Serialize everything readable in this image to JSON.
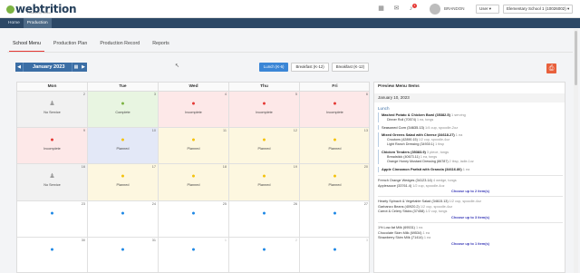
{
  "header": {
    "logo_text": "webtrition",
    "logo_tagline": "Powered by Sodexo",
    "notification_count": "1",
    "user_name": "BRANDON",
    "user_select": "User",
    "school_select": "Elementary School 1 (10026002)"
  },
  "nav": {
    "items": [
      "Home",
      "Production"
    ],
    "active": 1
  },
  "tabs": {
    "items": [
      "School Menu",
      "Production Plan",
      "Production Record",
      "Reports"
    ],
    "active": 0
  },
  "toolbar": {
    "prev": "◀",
    "month": "January 2023",
    "calendar_icon": "▦",
    "next": "▶",
    "meal_buttons": [
      "Lunch (K-6)",
      "Breakfast (K-12)",
      "Breakfast (K-12)"
    ],
    "active_meal": 0
  },
  "calendar": {
    "day_headers": [
      "Mon",
      "Tue",
      "Wed",
      "Thu",
      "Fri"
    ],
    "weeks": [
      [
        {
          "day": "2",
          "status": "No Service",
          "kind": "none"
        },
        {
          "day": "3",
          "status": "Complete",
          "kind": "complete"
        },
        {
          "day": "4",
          "status": "Incomplete",
          "kind": "incomplete"
        },
        {
          "day": "5",
          "status": "Incomplete",
          "kind": "incomplete"
        },
        {
          "day": "6",
          "status": "Incomplete",
          "kind": "incomplete"
        }
      ],
      [
        {
          "day": "9",
          "status": "Incomplete",
          "kind": "incomplete"
        },
        {
          "day": "10",
          "status": "Planned",
          "kind": "today"
        },
        {
          "day": "11",
          "status": "Planned",
          "kind": "planned"
        },
        {
          "day": "12",
          "status": "Planned",
          "kind": "planned"
        },
        {
          "day": "13",
          "status": "Planned",
          "kind": "planned"
        }
      ],
      [
        {
          "day": "16",
          "status": "No Service",
          "kind": "none"
        },
        {
          "day": "17",
          "status": "Planned",
          "kind": "planned"
        },
        {
          "day": "18",
          "status": "Planned",
          "kind": "planned"
        },
        {
          "day": "19",
          "status": "Planned",
          "kind": "planned"
        },
        {
          "day": "20",
          "status": "Planned",
          "kind": "planned"
        }
      ],
      [
        {
          "day": "23",
          "status": "",
          "kind": "empty"
        },
        {
          "day": "24",
          "status": "",
          "kind": "empty"
        },
        {
          "day": "25",
          "status": "",
          "kind": "empty"
        },
        {
          "day": "26",
          "status": "",
          "kind": "empty"
        },
        {
          "day": "27",
          "status": "",
          "kind": "empty"
        }
      ],
      [
        {
          "day": "30",
          "status": "",
          "kind": "empty"
        },
        {
          "day": "31",
          "status": "",
          "kind": "empty"
        },
        {
          "day": "1",
          "status": "",
          "kind": "empty",
          "out": true
        },
        {
          "day": "2",
          "status": "",
          "kind": "empty",
          "out": true
        },
        {
          "day": "3",
          "status": "",
          "kind": "empty",
          "out": true
        }
      ]
    ],
    "colors": {
      "none": "#9e9e9e",
      "complete": "#7cb342",
      "incomplete": "#e53935",
      "planned": "#f4c20d",
      "today": "#f4c20d",
      "empty": "#1e88e5"
    }
  },
  "preview": {
    "title": "Preview Menu Items",
    "date": "January 10, 2023",
    "meal": "Lunch",
    "groups": [
      {
        "items": [
          {
            "name": "Mashed Potato & Chicken Bowl (35382.5)",
            "serving": "1 serving",
            "sub": false
          },
          {
            "name": "Dinner Roll (70574)",
            "serving": "1 ea, tongs",
            "sub": true
          }
        ]
      },
      {
        "items": [
          {
            "name": "Seasoned Corn (34635.13)",
            "serving": "1/4 cup, spoodle-2oz",
            "plain": true
          }
        ]
      },
      {
        "items": [
          {
            "name": "Mixed Greens Salad with Cheese (34618.27)",
            "serving": "1 ea",
            "sub": false
          },
          {
            "name": "Croutons (42890.15)",
            "serving": "1/2 cup, spoodle-4oz",
            "sub": true
          },
          {
            "name": "Light Ranch Dressing (34930.1)",
            "serving": "1 tbsp",
            "sub": true
          }
        ]
      },
      {
        "items": [
          {
            "name": "Chicken Tenders (35383.9)",
            "serving": "3 piece, tongs",
            "sub": false
          },
          {
            "name": "Breadstick (40673.11)",
            "serving": "1 ea, tongs",
            "sub": true
          },
          {
            "name": "Orange Honey Mustard Dressing (86787)",
            "serving": "2 tbsp, ladle-1oz",
            "sub": true
          }
        ]
      },
      {
        "items": [
          {
            "name": "Apple Cinnamon Parfait with Granola (34616.80)",
            "serving": "1 ea",
            "sub": false
          }
        ]
      }
    ],
    "choose_blocks": [
      {
        "options": [
          {
            "name": "French Orange Wedges (34123.14)",
            "serving": "4 wedge, tongs"
          },
          {
            "name": "Applesauce (33761.4)",
            "serving": "1/2 cup, spoodle-4oz"
          }
        ],
        "choose": "Choose up to 2 item(s)"
      },
      {
        "options": [
          {
            "name": "Hearty Spinach & Vegetable Salad (34615.13)",
            "serving": "1/2 cup, spoodle-4oz"
          },
          {
            "name": "Garbanzo Beans (40920.2)",
            "serving": "1/2 cup, spoodle-4oz"
          },
          {
            "name": "Carrot & Celery Sticks (37458)",
            "serving": "1/2 cup, tongs"
          }
        ],
        "choose": "Choose up to 3 item(s)"
      },
      {
        "options": [
          {
            "name": "1% Low-fat Milk (69531)",
            "serving": "1 ea"
          },
          {
            "name": "Chocolate Skim Milk (69534)",
            "serving": "1 ea"
          },
          {
            "name": "Strawberry Skim Milk (71414)",
            "serving": "1 ea"
          }
        ],
        "choose": "Choose up to 1 item(s)"
      }
    ]
  },
  "icons": {
    "apple": "●",
    "person": "♟",
    "pdf": "⎙",
    "cursor": "↖"
  }
}
